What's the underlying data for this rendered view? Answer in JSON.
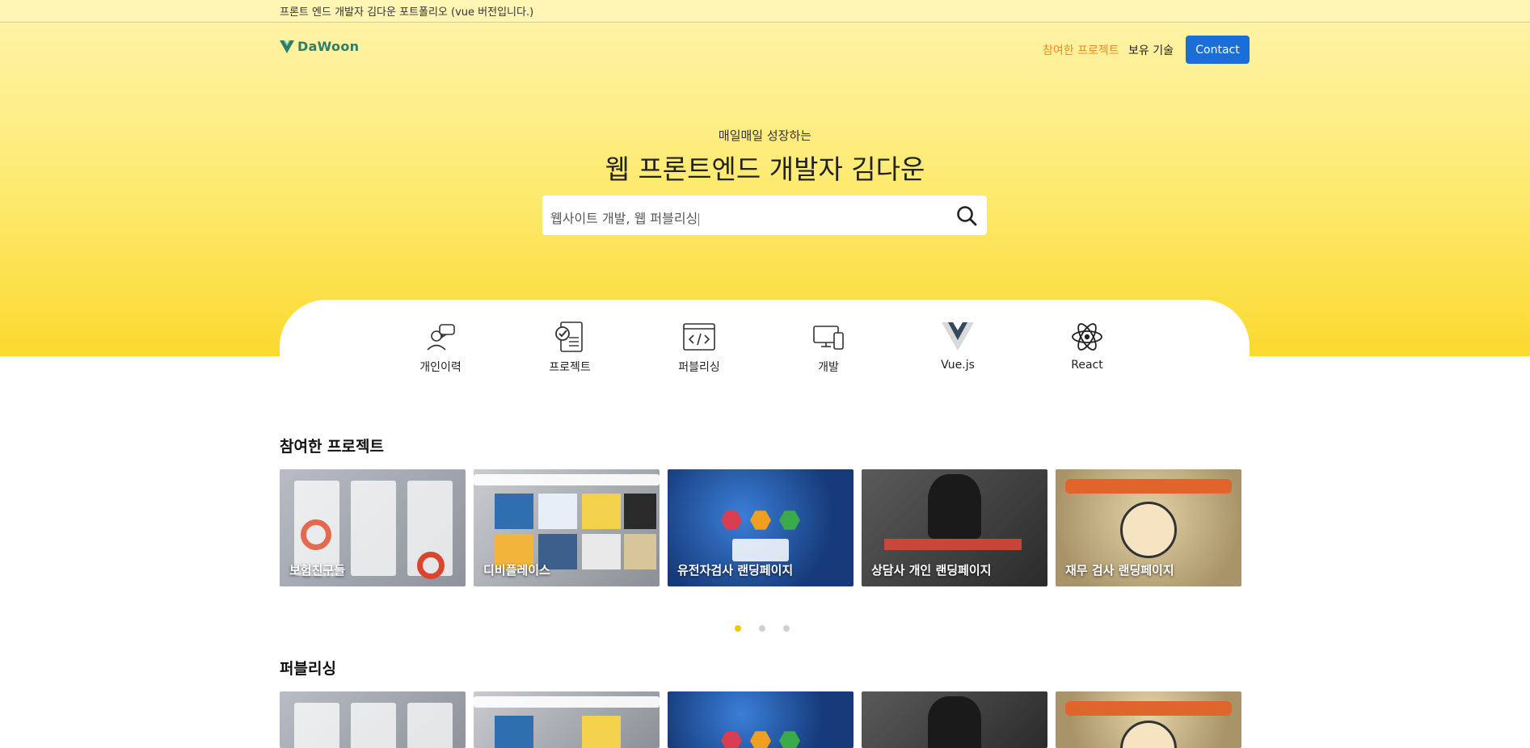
{
  "topbar": {
    "text": "프론트 엔드 개발자 김다운 포트폴리오 (vue 버전입니다.)"
  },
  "header": {
    "logo_text": "DaWoon",
    "nav": [
      {
        "label": "참여한 프로젝트",
        "active": true
      },
      {
        "label": "보유 기술",
        "active": false
      }
    ],
    "contact_label": "Contact"
  },
  "hero": {
    "subtitle": "매일매일 성장하는",
    "title": "웹 프론트엔드 개발자 김다운",
    "search_value": "웹사이트 개발, 웹 퍼블리싱",
    "search_icon": "search-icon"
  },
  "quick_menu": [
    {
      "label": "개인이력",
      "icon": "profile-chat-icon"
    },
    {
      "label": "프로젝트",
      "icon": "checklist-icon"
    },
    {
      "label": "퍼블리싱",
      "icon": "code-window-icon"
    },
    {
      "label": "개발",
      "icon": "devices-icon"
    },
    {
      "label": "Vue.js",
      "icon": "vue-logo-icon"
    },
    {
      "label": "React",
      "icon": "react-atom-icon"
    }
  ],
  "sections": {
    "projects": {
      "title": "참여한 프로젝트",
      "cards": [
        "보험친구들",
        "디비플레이스",
        "유전자검사 랜딩페이지",
        "상담사 개인 랜딩페이지",
        "재무 검사 랜딩페이지"
      ]
    },
    "publishing": {
      "title": "퍼블리싱"
    }
  },
  "carousel": {
    "pages": 3,
    "active_index": 0
  },
  "colors": {
    "accent": "#f7c600",
    "contact": "#1a6ed8",
    "nav_active": "#f08a24",
    "hero_top": "#fff3a6",
    "hero_bottom": "#fbd92e"
  }
}
